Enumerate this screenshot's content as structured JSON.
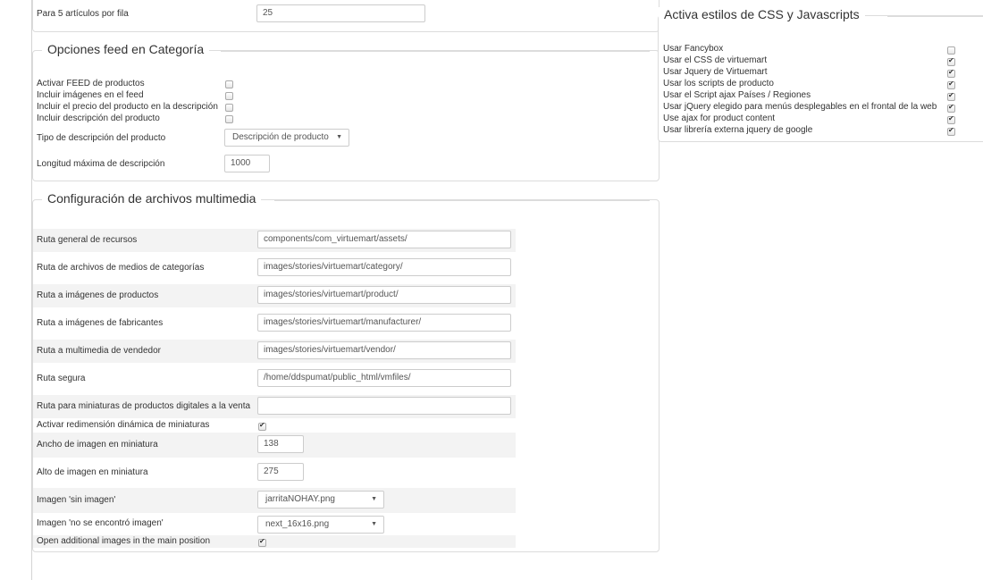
{
  "top": {
    "per_row_label": "Para 5 artículos por fila",
    "per_row_value": "25"
  },
  "feed": {
    "title": "Opciones feed en Categoría",
    "rows": [
      {
        "label": "Activar FEED de productos",
        "checked": false
      },
      {
        "label": "Incluir imágenes en el feed",
        "checked": false
      },
      {
        "label": "Incluir el precio del producto en la descripción",
        "checked": false
      },
      {
        "label": "Incluir descripción del producto",
        "checked": false
      }
    ],
    "desc_type_label": "Tipo de descripción del producto",
    "desc_type_value": "Descripción de producto",
    "max_len_label": "Longitud máxima de descripción",
    "max_len_value": "1000"
  },
  "media": {
    "title": "Configuración de archivos multimedia",
    "paths": [
      {
        "label": "Ruta general de recursos",
        "value": "components/com_virtuemart/assets/"
      },
      {
        "label": "Ruta de archivos de medios de categorías",
        "value": "images/stories/virtuemart/category/"
      },
      {
        "label": "Ruta a imágenes de productos",
        "value": "images/stories/virtuemart/product/"
      },
      {
        "label": "Ruta a imágenes de fabricantes",
        "value": "images/stories/virtuemart/manufacturer/"
      },
      {
        "label": "Ruta a multimedia de vendedor",
        "value": "images/stories/virtuemart/vendor/"
      },
      {
        "label": "Ruta segura",
        "value": "/home/ddspumat/public_html/vmfiles/"
      },
      {
        "label": "Ruta para miniaturas de productos digitales a la venta",
        "value": ""
      }
    ],
    "dyn_resize_label": "Activar redimensión dinámica de miniaturas",
    "dyn_resize_checked": true,
    "thumb_w_label": "Ancho de imagen en miniatura",
    "thumb_w_value": "138",
    "thumb_h_label": "Alto de imagen en miniatura",
    "thumb_h_value": "275",
    "no_image_label": "Imagen 'sin imagen'",
    "no_image_value": "jarritaNOHAY.png",
    "not_found_label": "Imagen 'no se encontró imagen'",
    "not_found_value": "next_16x16.png",
    "additional_label": "Open additional images in the main position",
    "additional_checked": true
  },
  "css_js": {
    "title": "Activa estilos de CSS y Javascripts",
    "rows": [
      {
        "label": "Usar Fancybox",
        "checked": false
      },
      {
        "label": "Usar el CSS de virtuemart",
        "checked": true
      },
      {
        "label": "Usar Jquery de Virtuemart",
        "checked": true
      },
      {
        "label": "Usar los scripts de producto",
        "checked": true
      },
      {
        "label": "Usar el Script ajax Países / Regiones",
        "checked": true
      },
      {
        "label": "Usar jQuery elegido para menús desplegables en el frontal de la web",
        "checked": true
      },
      {
        "label": "Use ajax for product content",
        "checked": true
      },
      {
        "label": "Usar librería externa jquery de google",
        "checked": true
      }
    ]
  },
  "icons": {
    "caret": "caret-down-icon",
    "check": "check-icon"
  }
}
